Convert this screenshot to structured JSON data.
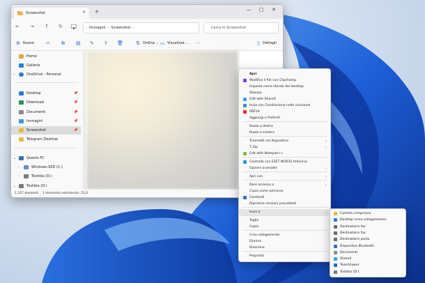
{
  "explorer": {
    "tab_title": "Screenshot",
    "tab_close": "×",
    "new_tab": "+",
    "breadcrumbs": [
      "Immagini",
      "Screenshot"
    ],
    "search_placeholder": "Cerca in Screenshot",
    "toolbar": {
      "new_label": "Nuovo",
      "sort_label": "Ordina",
      "view_label": "Visualizza",
      "more_label": "···",
      "details_label": "Dettagli"
    },
    "nav": [
      {
        "label": "Home",
        "color": "#e8a33a"
      },
      {
        "label": "Galleria",
        "color": "#2b7bd6"
      },
      {
        "label": "OneDrive - Personal",
        "color": "#2b7bd6"
      },
      {
        "label": "Desktop",
        "color": "#2b7bd6"
      },
      {
        "label": "Download",
        "color": "#2f8f4e"
      },
      {
        "label": "Documenti",
        "color": "#8a8a8a"
      },
      {
        "label": "Immagini",
        "color": "#3a9ad9"
      },
      {
        "label": "Screenshot",
        "color": "#e8b64a"
      },
      {
        "label": "Telegram Desktop",
        "color": "#e8b64a"
      },
      {
        "label": "Questo PC",
        "color": "#3a6fb0"
      },
      {
        "label": "Windows-SSD (C:)",
        "color": "#6b8fb8"
      },
      {
        "label": "Toshiba (D:)",
        "color": "#7a7a7a"
      },
      {
        "label": "Toshiba (D:)",
        "color": "#7a7a7a"
      }
    ],
    "status": {
      "count": "1.327 elementi",
      "selected": "1 elemento selezionato",
      "size": "21,0"
    }
  },
  "context_menu": [
    {
      "label": "Apri",
      "bold": true
    },
    {
      "label": "Modifica il file con Clipchamp",
      "color": "#7b3fe4"
    },
    {
      "label": "Imposta come sfondo del desktop"
    },
    {
      "label": "Stampa"
    },
    {
      "label": "Edit with ShareX",
      "color": "#3aa0e0"
    },
    {
      "label": "Invia con Condivisione nelle vicinanze",
      "color": "#3a8fe0"
    },
    {
      "label": "PDF24",
      "color": "#d9302c"
    },
    {
      "label": "Aggiungi a Preferiti"
    },
    {
      "label": "Ruota a destra"
    },
    {
      "label": "Ruota a sinistra"
    },
    {
      "label": "Trasmetti nel dispositivo",
      "submenu": true
    },
    {
      "label": "7-Zip",
      "submenu": true
    },
    {
      "label": "Edit with Notepad++",
      "color": "#7bbf3a"
    },
    {
      "label": "Controlla con ESET NOD32 Antivirus",
      "color": "#1e9bd7"
    },
    {
      "label": "Opzioni avanzate",
      "submenu": true
    },
    {
      "label": "Apri con",
      "submenu": true
    },
    {
      "label": "Dare accesso a",
      "submenu": true
    },
    {
      "label": "Copia come percorso"
    },
    {
      "label": "Condividi",
      "color": "#3a6fb0"
    },
    {
      "label": "Ripristina versioni precedenti"
    },
    {
      "label": "Invia a",
      "submenu": true
    },
    {
      "label": "Taglia"
    },
    {
      "label": "Copia"
    },
    {
      "label": "Crea collegamento"
    },
    {
      "label": "Elimina"
    },
    {
      "label": "Rinomina"
    },
    {
      "label": "Proprietà"
    }
  ],
  "submenu": [
    {
      "label": "Cartella compressa",
      "color": "#e8b64a"
    },
    {
      "label": "Desktop (crea collegamento)",
      "color": "#2b7bd6"
    },
    {
      "label": "Destinatario fax",
      "color": "#6b6b6b"
    },
    {
      "label": "Destinatario fax",
      "color": "#6b6b6b"
    },
    {
      "label": "Destinatario posta",
      "color": "#6b6b6b"
    },
    {
      "label": "Dispositivo Bluetooth",
      "color": "#2b6fd6"
    },
    {
      "label": "Documenti",
      "color": "#8a8a8a"
    },
    {
      "label": "ShareX",
      "color": "#3aa0e0"
    },
    {
      "label": "TeamViewer",
      "color": "#1f6fd1"
    },
    {
      "label": "Toshiba (D:)",
      "color": "#7a7a7a"
    }
  ]
}
